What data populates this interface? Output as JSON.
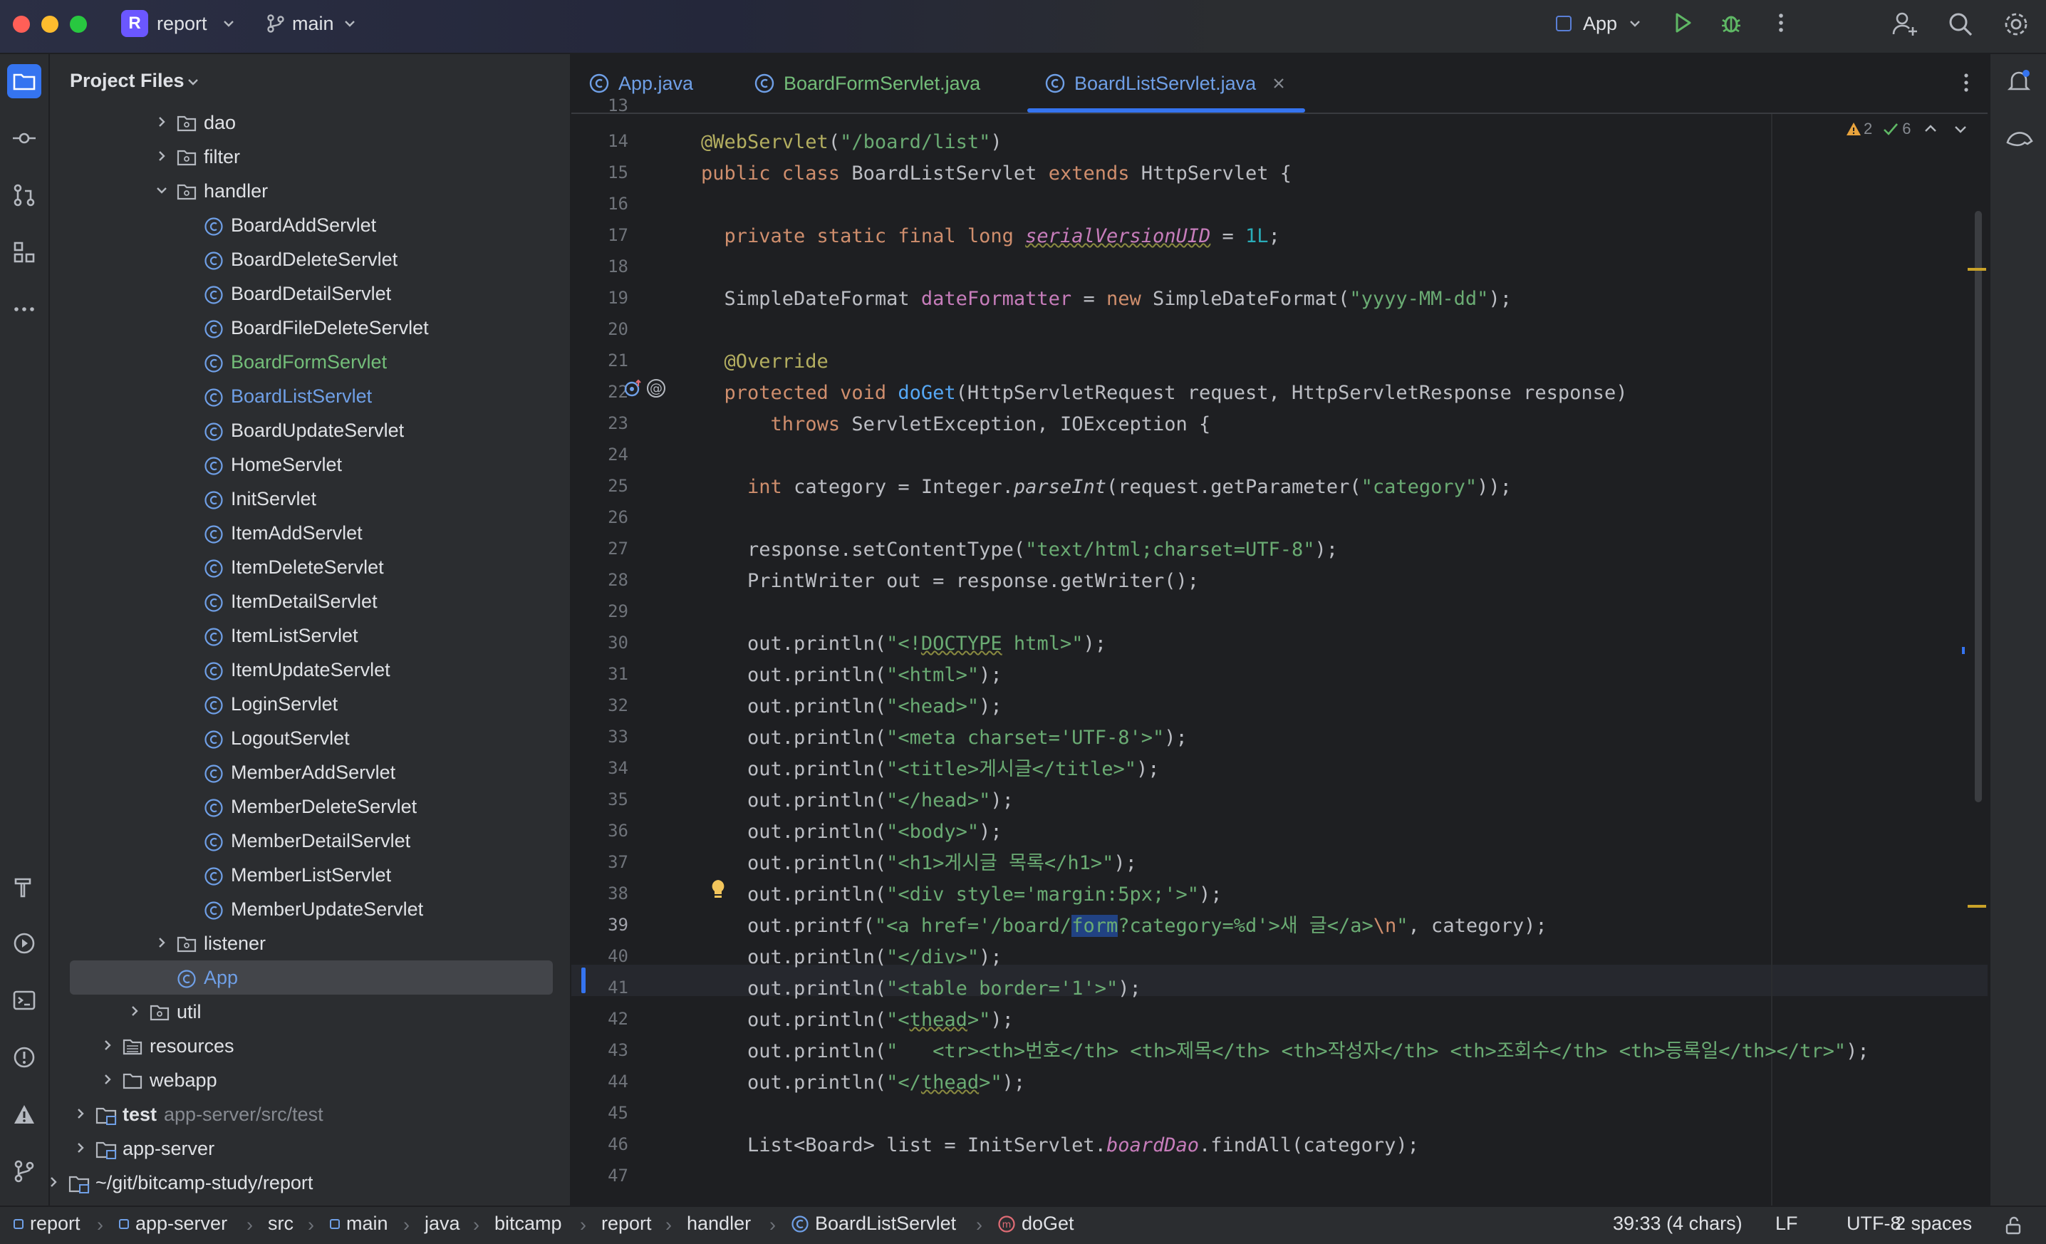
{
  "titlebar": {
    "project_badge": "R",
    "project_name": "report",
    "branch": "main",
    "run_config": "App"
  },
  "project_panel": {
    "title": "Project Files",
    "tree": [
      {
        "label": "dao",
        "type": "folder",
        "expanded": false,
        "depth": 7
      },
      {
        "label": "filter",
        "type": "folder",
        "expanded": false,
        "depth": 7
      },
      {
        "label": "handler",
        "type": "folder",
        "expanded": true,
        "depth": 7
      },
      {
        "label": "BoardAddServlet",
        "type": "class",
        "depth": 8
      },
      {
        "label": "BoardDeleteServlet",
        "type": "class",
        "depth": 8
      },
      {
        "label": "BoardDetailServlet",
        "type": "class",
        "depth": 8
      },
      {
        "label": "BoardFileDeleteServlet",
        "type": "class",
        "depth": 8
      },
      {
        "label": "BoardFormServlet",
        "type": "class",
        "depth": 8,
        "color": "#73bd79"
      },
      {
        "label": "BoardListServlet",
        "type": "class",
        "depth": 8,
        "color": "#6f9fe6"
      },
      {
        "label": "BoardUpdateServlet",
        "type": "class",
        "depth": 8
      },
      {
        "label": "HomeServlet",
        "type": "class",
        "depth": 8
      },
      {
        "label": "InitServlet",
        "type": "class",
        "depth": 8
      },
      {
        "label": "ItemAddServlet",
        "type": "class",
        "depth": 8
      },
      {
        "label": "ItemDeleteServlet",
        "type": "class",
        "depth": 8
      },
      {
        "label": "ItemDetailServlet",
        "type": "class",
        "depth": 8
      },
      {
        "label": "ItemListServlet",
        "type": "class",
        "depth": 8
      },
      {
        "label": "ItemUpdateServlet",
        "type": "class",
        "depth": 8
      },
      {
        "label": "LoginServlet",
        "type": "class",
        "depth": 8
      },
      {
        "label": "LogoutServlet",
        "type": "class",
        "depth": 8
      },
      {
        "label": "MemberAddServlet",
        "type": "class",
        "depth": 8
      },
      {
        "label": "MemberDeleteServlet",
        "type": "class",
        "depth": 8
      },
      {
        "label": "MemberDetailServlet",
        "type": "class",
        "depth": 8
      },
      {
        "label": "MemberListServlet",
        "type": "class",
        "depth": 8
      },
      {
        "label": "MemberUpdateServlet",
        "type": "class",
        "depth": 8
      },
      {
        "label": "listener",
        "type": "folder",
        "expanded": false,
        "depth": 7
      },
      {
        "label": "App",
        "type": "class",
        "depth": 7,
        "selected": true,
        "color": "#6f9fe6"
      },
      {
        "label": "util",
        "type": "folder",
        "expanded": false,
        "depth": 6
      },
      {
        "label": "resources",
        "type": "resfolder",
        "expanded": false,
        "depth": 5
      },
      {
        "label": "webapp",
        "type": "folder",
        "expanded": false,
        "depth": 5
      },
      {
        "label": "test",
        "sub": "app-server/src/test",
        "type": "module",
        "expanded": false,
        "depth": 4,
        "bold": true
      },
      {
        "label": "app-server",
        "type": "module",
        "expanded": false,
        "depth": 4
      },
      {
        "label": "~/git/bitcamp-study/report",
        "type": "module",
        "expanded": false,
        "depth": 3
      }
    ]
  },
  "tabs": [
    {
      "label": "App.java",
      "active": false
    },
    {
      "label": "BoardFormServlet.java",
      "active": false,
      "color": "#73bd79"
    },
    {
      "label": "BoardListServlet.java",
      "active": true,
      "color": "#6f9fe6"
    }
  ],
  "inspections": {
    "warnings": "2",
    "ok": "6"
  },
  "gutter": {
    "partial_top": "13"
  },
  "code_lines": [
    {
      "n": "14",
      "html": "<span class=\"ann\">@WebServlet</span>(<span class=\"str\">\"/board/list\"</span>)"
    },
    {
      "n": "15",
      "html": "<span class=\"kw\">public class</span> BoardListServlet <span class=\"kw\">extends</span> HttpServlet {"
    },
    {
      "n": "16",
      "html": ""
    },
    {
      "n": "17",
      "html": "  <span class=\"kw\">private static final long</span> <span class=\"sfld squig\">serialVersionUID</span> = <span class=\"num\">1L</span>;"
    },
    {
      "n": "18",
      "html": ""
    },
    {
      "n": "19",
      "html": "  SimpleDateFormat <span class=\"fld\">dateFormatter</span> = <span class=\"kw\">new</span> SimpleDateFormat(<span class=\"str\">\"yyyy-MM-dd\"</span>);"
    },
    {
      "n": "20",
      "html": ""
    },
    {
      "n": "21",
      "html": "  <span class=\"ann\">@Override</span>"
    },
    {
      "n": "22",
      "html": "  <span class=\"kw\">protected void</span> <span class=\"fn\">doGet</span>(HttpServletRequest request, HttpServletResponse response)"
    },
    {
      "n": "23",
      "html": "      <span class=\"kw\">throws</span> ServletException, IOException {"
    },
    {
      "n": "24",
      "html": ""
    },
    {
      "n": "25",
      "html": "    <span class=\"kw\">int</span> category = Integer.<span class=\"it\">parseInt</span>(request.getParameter(<span class=\"str\">\"category\"</span>));"
    },
    {
      "n": "26",
      "html": ""
    },
    {
      "n": "27",
      "html": "    response.setContentType(<span class=\"str\">\"text/html;charset=UTF-8\"</span>);"
    },
    {
      "n": "28",
      "html": "    PrintWriter out = response.getWriter();"
    },
    {
      "n": "29",
      "html": ""
    },
    {
      "n": "30",
      "html": "    out.println(<span class=\"str\">\"&lt;!<span class=\"squig\">DOCTYPE</span> html&gt;\"</span>);"
    },
    {
      "n": "31",
      "html": "    out.println(<span class=\"str\">\"&lt;html&gt;\"</span>);"
    },
    {
      "n": "32",
      "html": "    out.println(<span class=\"str\">\"&lt;head&gt;\"</span>);"
    },
    {
      "n": "33",
      "html": "    out.println(<span class=\"str\">\"&lt;meta charset='UTF-8'&gt;\"</span>);"
    },
    {
      "n": "34",
      "html": "    out.println(<span class=\"str\">\"&lt;title&gt;게시글&lt;/title&gt;\"</span>);"
    },
    {
      "n": "35",
      "html": "    out.println(<span class=\"str\">\"&lt;/head&gt;\"</span>);"
    },
    {
      "n": "36",
      "html": "    out.println(<span class=\"str\">\"&lt;body&gt;\"</span>);"
    },
    {
      "n": "37",
      "html": "    out.println(<span class=\"str\">\"&lt;h1&gt;게시글 목록&lt;/h1&gt;\"</span>);"
    },
    {
      "n": "38",
      "html": "    out.println(<span class=\"str\">\"&lt;div style='margin:5px;'&gt;\"</span>);"
    },
    {
      "n": "39",
      "html": "    out.printf(<span class=\"str\">\"&lt;a href='/board/<span class=\"hl\">form</span>?category=%d'&gt;새 글&lt;/a&gt;<span class=\"kw\">\\n</span>\"</span>, category);"
    },
    {
      "n": "40",
      "html": "    out.println(<span class=\"str\">\"&lt;/div&gt;\"</span>);"
    },
    {
      "n": "41",
      "html": "    out.println(<span class=\"str\">\"&lt;table border='1'&gt;\"</span>);"
    },
    {
      "n": "42",
      "html": "    out.println(<span class=\"str\">\"&lt;<span class=\"squig\">thead</span>&gt;\"</span>);"
    },
    {
      "n": "43",
      "html": "    out.println(<span class=\"str\">\"   &lt;tr&gt;&lt;th&gt;번호&lt;/th&gt; &lt;th&gt;제목&lt;/th&gt; &lt;th&gt;작성자&lt;/th&gt; &lt;th&gt;조회수&lt;/th&gt; &lt;th&gt;등록일&lt;/th&gt;&lt;/tr&gt;\"</span>);"
    },
    {
      "n": "44",
      "html": "    out.println(<span class=\"str\">\"&lt;/<span class=\"squig\">thead</span>&gt;\"</span>);"
    },
    {
      "n": "45",
      "html": ""
    },
    {
      "n": "46",
      "html": "    List&lt;Board&gt; list = InitServlet.<span class=\"sfld\">boardDao</span>.findAll(category);"
    },
    {
      "n": "47",
      "html": ""
    }
  ],
  "breadcrumbs": [
    "report",
    "app-server",
    "src",
    "main",
    "java",
    "bitcamp",
    "report",
    "handler",
    "BoardListServlet",
    "doGet"
  ],
  "status": {
    "position": "39:33 (4 chars)",
    "line_sep": "LF",
    "encoding": "UTF-8",
    "indent": "2 spaces"
  },
  "colors": {
    "accent": "#3574f0",
    "class_icon": "#6f9fe6",
    "modified": "#73bd79"
  }
}
